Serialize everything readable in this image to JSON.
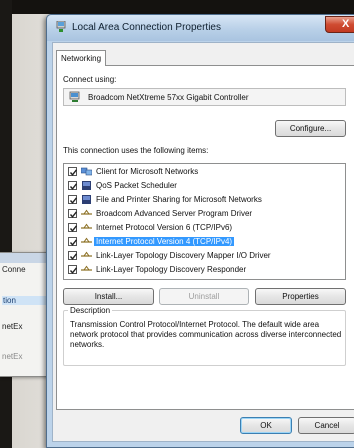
{
  "background_window": {
    "items": [
      "Conne",
      "tion",
      "netEx",
      "netEx"
    ]
  },
  "dialog": {
    "title": "Local Area Connection Properties",
    "close_glyph": "X",
    "tab_label": "Networking",
    "connect_using_label": "Connect using:",
    "adapter_name": "Broadcom NetXtreme 57xx Gigabit Controller",
    "configure_button": "Configure...",
    "items_label": "This connection uses the following items:",
    "items": [
      {
        "label": "Client for Microsoft Networks",
        "checked": true,
        "icon": "network-client-icon",
        "selected": false
      },
      {
        "label": "QoS Packet Scheduler",
        "checked": true,
        "icon": "service-icon",
        "selected": false
      },
      {
        "label": "File and Printer Sharing for Microsoft Networks",
        "checked": true,
        "icon": "service-icon",
        "selected": false
      },
      {
        "label": "Broadcom Advanced Server Program Driver",
        "checked": true,
        "icon": "protocol-icon",
        "selected": false
      },
      {
        "label": "Internet Protocol Version 6 (TCP/IPv6)",
        "checked": true,
        "icon": "protocol-icon",
        "selected": false
      },
      {
        "label": "Internet Protocol Version 4 (TCP/IPv4)",
        "checked": true,
        "icon": "protocol-icon",
        "selected": true
      },
      {
        "label": "Link-Layer Topology Discovery Mapper I/O Driver",
        "checked": true,
        "icon": "protocol-icon",
        "selected": false
      },
      {
        "label": "Link-Layer Topology Discovery Responder",
        "checked": true,
        "icon": "protocol-icon",
        "selected": false
      }
    ],
    "install_button": "Install...",
    "uninstall_button": "Uninstall",
    "properties_button": "Properties",
    "description_title": "Description",
    "description_text": "Transmission Control Protocol/Internet Protocol. The default wide area network protocol that provides communication across diverse interconnected networks.",
    "ok_button": "OK",
    "cancel_button": "Cancel"
  },
  "colors": {
    "selection": "#3399ff",
    "titlebar": "#b9d0e8",
    "close": "#cf4b31"
  }
}
